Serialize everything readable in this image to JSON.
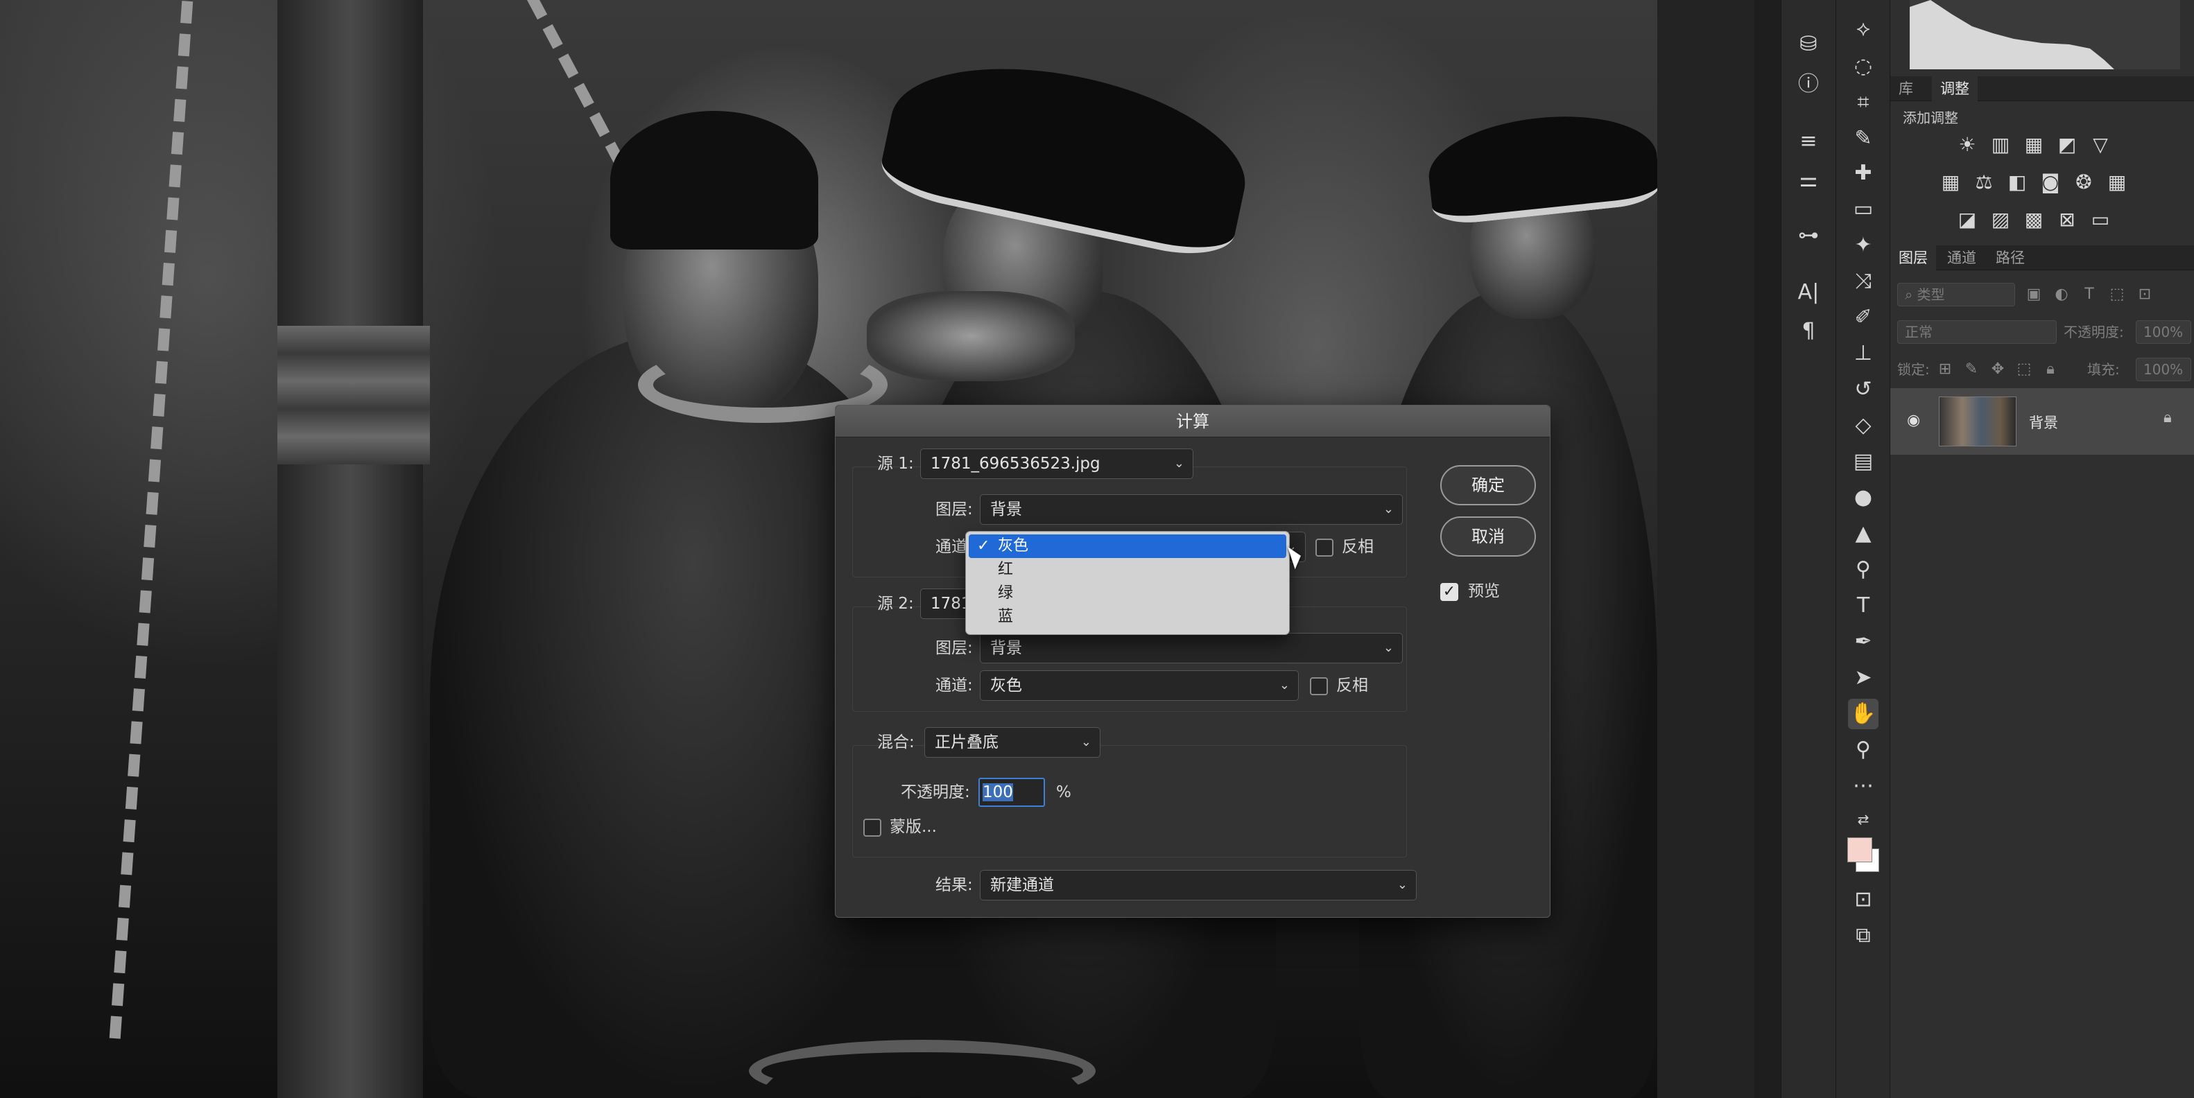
{
  "dialog": {
    "title": "计算",
    "source1": {
      "label": "源 1:",
      "file": "1781_696536523.jpg",
      "layer_label": "图层:",
      "layer": "背景",
      "channel_label": "通道:",
      "channel": "灰色",
      "invert_label": "反相",
      "invert_checked": false
    },
    "source2": {
      "label": "源 2:",
      "file": "1781",
      "layer_label": "图层:",
      "layer": "背景",
      "channel_label": "通道:",
      "channel": "灰色",
      "invert_label": "反相",
      "invert_checked": false
    },
    "blend": {
      "label": "混合:",
      "mode": "正片叠底",
      "opacity_label": "不透明度:",
      "opacity": "100",
      "opacity_unit": "%",
      "mask_label": "蒙版...",
      "mask_checked": false
    },
    "result": {
      "label": "结果:",
      "value": "新建通道"
    },
    "buttons": {
      "ok": "确定",
      "cancel": "取消"
    },
    "preview": {
      "label": "预览",
      "checked": true
    }
  },
  "channel_popup": {
    "checkmark": "✓",
    "selected": 0,
    "options": [
      "灰色",
      "红",
      "绿",
      "蓝"
    ]
  },
  "panel": {
    "tabs_top": [
      "库",
      "调整"
    ],
    "adjust_header": "添加调整",
    "tabs_layers": [
      "图层",
      "通道",
      "路径"
    ],
    "filter_placeholder": "类型",
    "blend_mode": "正常",
    "opacity_label": "不透明度:",
    "opacity_value": "100%",
    "lock_label": "锁定:",
    "fill_label": "填充:",
    "fill_value": "100%",
    "layer_name": "背景"
  },
  "colors": {
    "accent": "#1f6ad6",
    "foreground_swatch": "#f6d3cd",
    "background_swatch": "#ffffff"
  }
}
